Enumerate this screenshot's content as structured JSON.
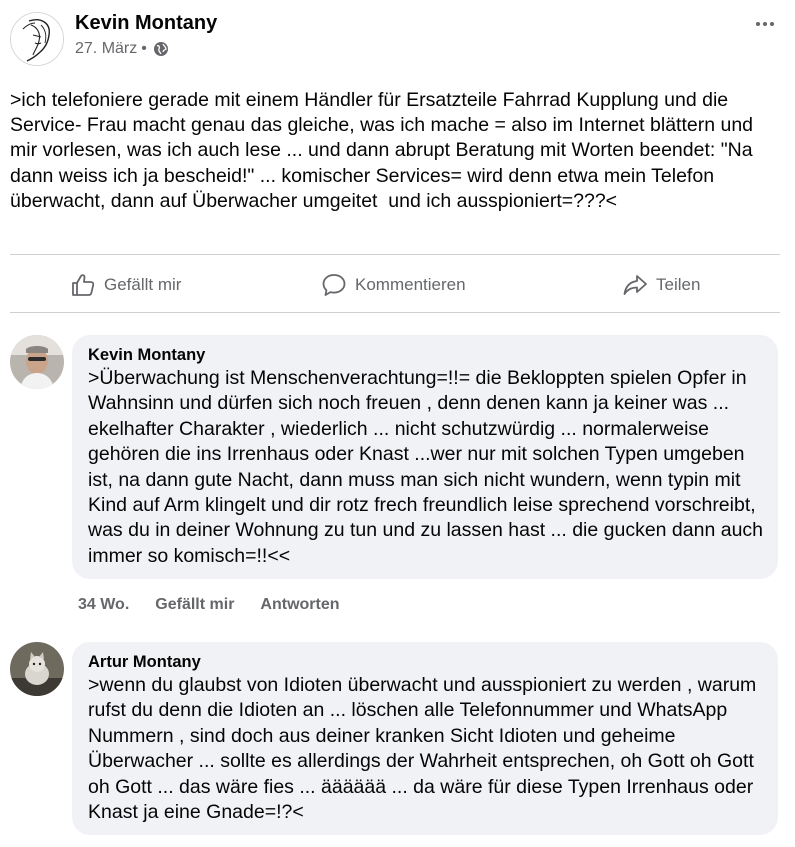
{
  "post": {
    "author": "Kevin Montany",
    "date": "27. März",
    "separator": "•",
    "visibility_icon": "globe-icon",
    "more_icon": "more-options-icon",
    "text": ">ich telefoniere gerade mit einem Händler für Ersatzteile Fahrrad Kupplung und die Service- Frau macht genau das gleiche, was ich mache = also im Internet blättern und mir vorlesen, was ich auch lese ... und dann abrupt Beratung mit Worten beendet: \"Na dann weiss ich ja bescheid!\" ... komischer Services= wird denn etwa mein Telefon überwacht, dann auf Überwacher umgeitet  und ich ausspioniert=???<"
  },
  "actions": {
    "like_label": "Gefällt mir",
    "comment_label": "Kommentieren",
    "share_label": "Teilen"
  },
  "comments": [
    {
      "author": "Kevin Montany",
      "text": ">Überwachung ist Menschenverachtung=!!= die Bekloppten spielen Opfer in Wahnsinn und dürfen sich noch freuen , denn denen kann ja keiner was ... ekelhafter Charakter , wiederlich ... nicht schutzwürdig ... normalerweise gehören die ins Irrenhaus oder Knast ...wer nur mit solchen Typen umgeben ist, na dann gute Nacht, dann muss man sich nicht wundern, wenn typin mit Kind auf Arm klingelt und dir rotz frech freundlich leise sprechend vorschreibt, was du in deiner Wohnung zu tun und zu lassen hast ... die gucken dann auch immer so komisch=!!<<",
      "time": "34 Wo.",
      "like_label": "Gefällt mir",
      "reply_label": "Antworten"
    },
    {
      "author": "Artur Montany",
      "text": ">wenn du glaubst von Idioten überwacht und ausspioniert zu werden , warum rufst du denn die Idioten an ... löschen alle Telefonnummer und WhatsApp Nummern , sind doch aus deiner kranken Sicht Idioten und geheime Überwacher ... sollte es allerdings der Wahrheit entsprechen, oh Gott oh Gott oh Gott ... das wäre fies ... ääääää ... da wäre für diese Typen Irrenhaus oder Knast ja eine Gnade=!?<"
    }
  ],
  "colors": {
    "text": "#050505",
    "secondary": "#65676b",
    "bubble": "#f0f2f5",
    "divider": "#ced0d4"
  }
}
